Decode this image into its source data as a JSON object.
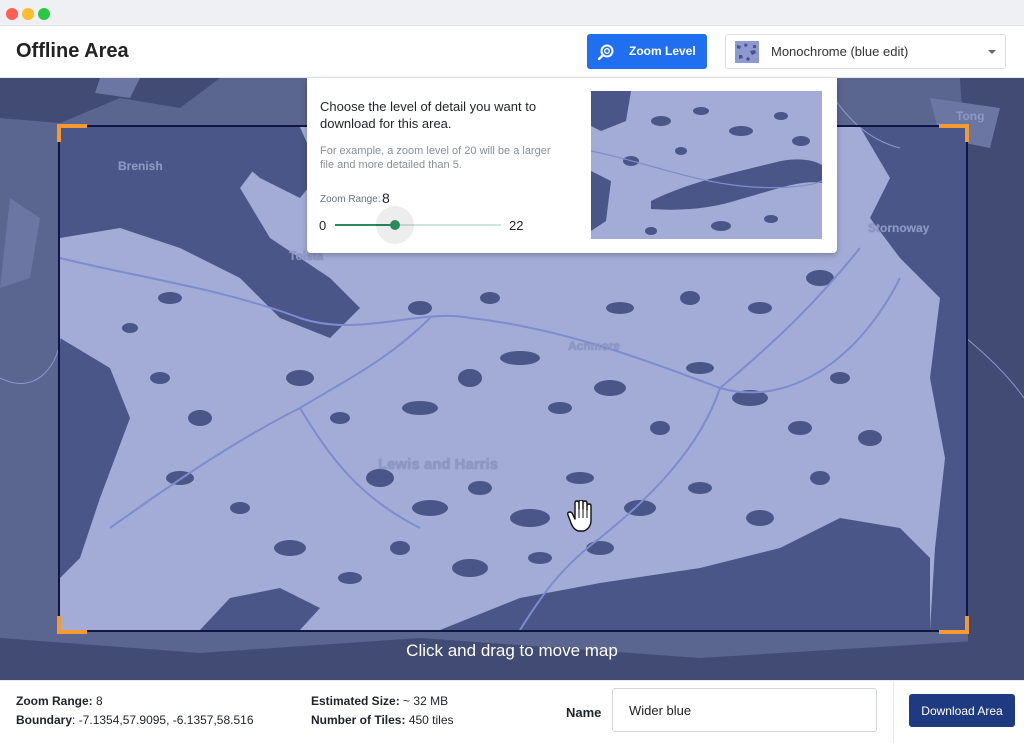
{
  "header": {
    "title": "Offline Area",
    "zoom_button_label": "Zoom Level",
    "style_select_value": "Monochrome (blue edit)"
  },
  "zoom_popover": {
    "title": "Choose the level of detail you want to download for this area.",
    "description": "For example, a zoom level of 20 will be a larger file and more detailed than 5.",
    "zoom_range_label": "Zoom Range:",
    "zoom_value": "8",
    "min_label": "0",
    "max_label": "22",
    "slider": {
      "min": 0,
      "max": 22,
      "value": 8
    }
  },
  "map": {
    "hint": "Click and drag to move map",
    "places": [
      "Brenish",
      "Tolsta",
      "Stornoway",
      "Achmore",
      "Lewis and Harris",
      "Tong"
    ]
  },
  "footer": {
    "zoom_range_label": "Zoom Range:",
    "zoom_range_value": "8",
    "boundary_label": "Boundary",
    "boundary_value": "-7.1354,57.9095, -6.1357,58.516",
    "estimated_size_label": "Estimated Size:",
    "estimated_size_value": "~ 32 MB",
    "tiles_label": "Number of Tiles:",
    "tiles_value": "450 tiles",
    "name_label": "Name",
    "name_value": "Wider blue",
    "download_label": "Download Area"
  },
  "colors": {
    "primary": "#1f6ff0",
    "download": "#1e3a80",
    "slider": "#2b8a5e",
    "handles": "#f39a32",
    "land": "#a3acd6",
    "water": "#4a5688"
  }
}
